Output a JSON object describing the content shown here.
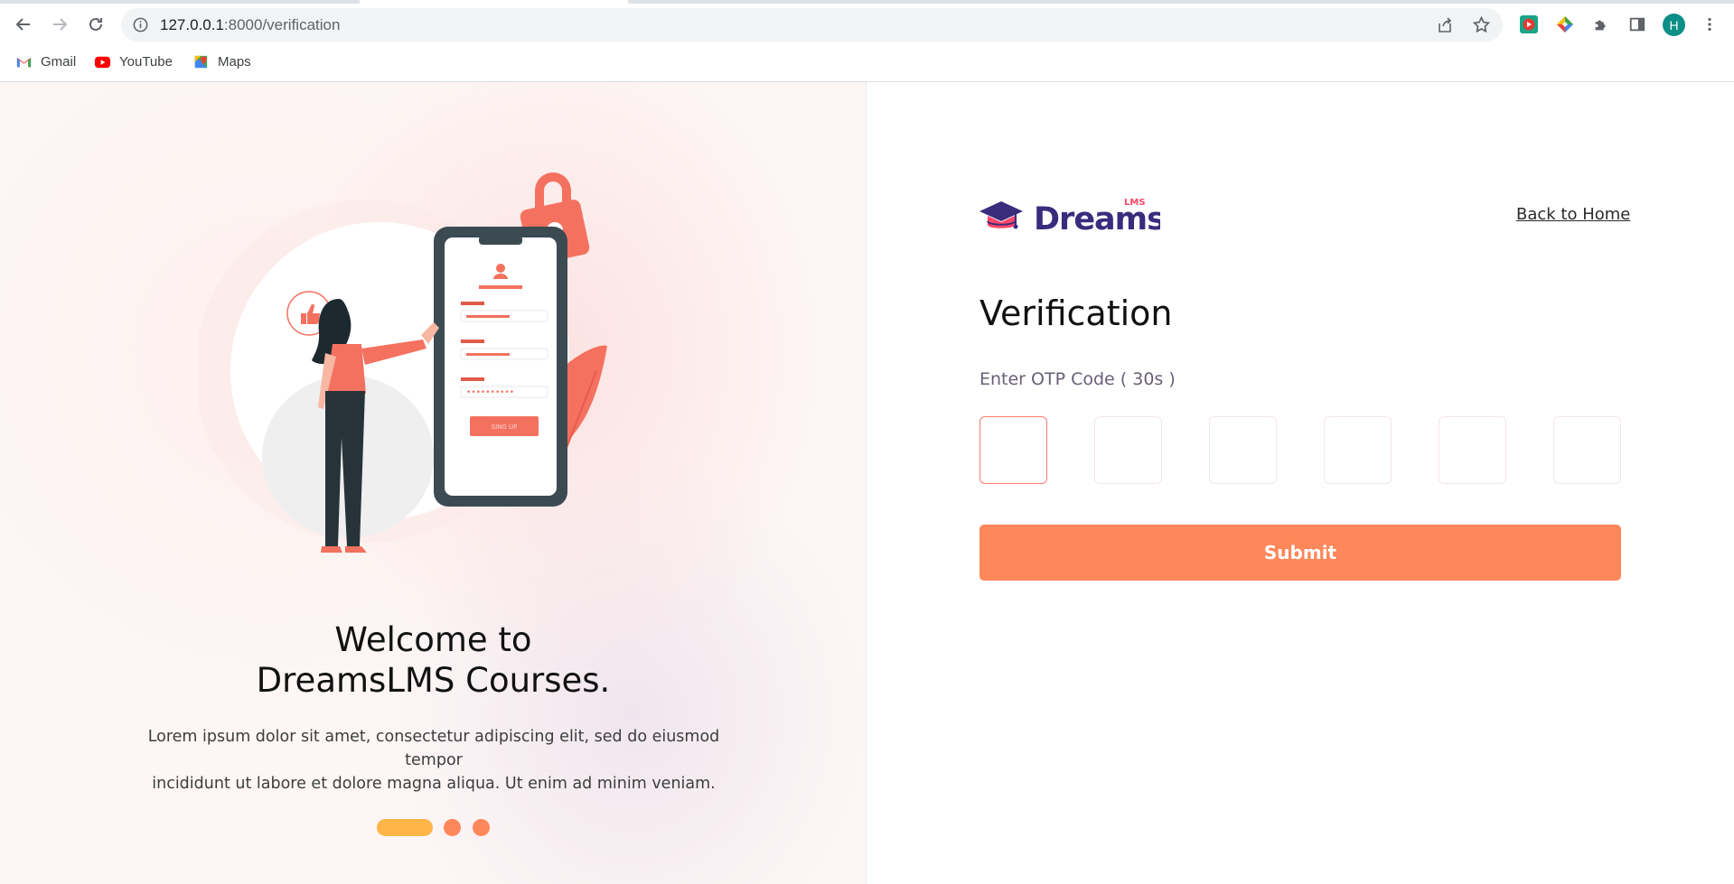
{
  "browser": {
    "url_host": "127.0.0.1",
    "url_path": ":8000/verification",
    "profile_initial": "H",
    "bookmarks": [
      {
        "label": "Gmail",
        "icon": "gmail-icon"
      },
      {
        "label": "YouTube",
        "icon": "youtube-icon"
      },
      {
        "label": "Maps",
        "icon": "maps-icon"
      }
    ]
  },
  "left": {
    "welcome_line1": "Welcome to",
    "welcome_line2": "DreamsLMS Courses.",
    "description_line1": "Lorem ipsum dolor sit amet, consectetur adipiscing elit, sed do eiusmod tempor",
    "description_line2": "incididunt ut labore et dolore magna aliqua. Ut enim ad minim veniam.",
    "carousel_active_index": 0,
    "carousel_count": 3,
    "illustration_button_text": "SING UP"
  },
  "right": {
    "logo_text": "Dreams",
    "logo_sup": "LMS",
    "back_home": "Back to Home",
    "title": "Verification",
    "otp_label": "Enter OTP Code ( 30s )",
    "otp_boxes": [
      "",
      "",
      "",
      "",
      "",
      ""
    ],
    "submit_label": "Submit"
  },
  "colors": {
    "accent": "#ff875a",
    "carousel_active": "#ffb648",
    "brand_purple": "#392c7d",
    "brand_pink": "#ff4667",
    "otp_active_border": "#ff7a6b"
  }
}
